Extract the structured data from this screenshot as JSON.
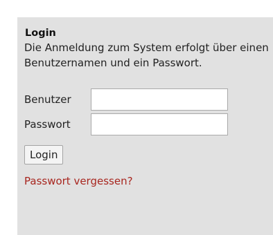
{
  "login": {
    "title": "Login",
    "description": "Die Anmeldung zum System erfolgt über einen Benutzernamen und ein Passwort.",
    "username_label": "Benutzer",
    "username_value": "",
    "password_label": "Passwort",
    "password_value": "",
    "submit_label": "Login",
    "forgot_password_link": "Passwort vergessen?"
  },
  "colors": {
    "panel_background": "#e1e1e1",
    "link": "#a8261f"
  }
}
